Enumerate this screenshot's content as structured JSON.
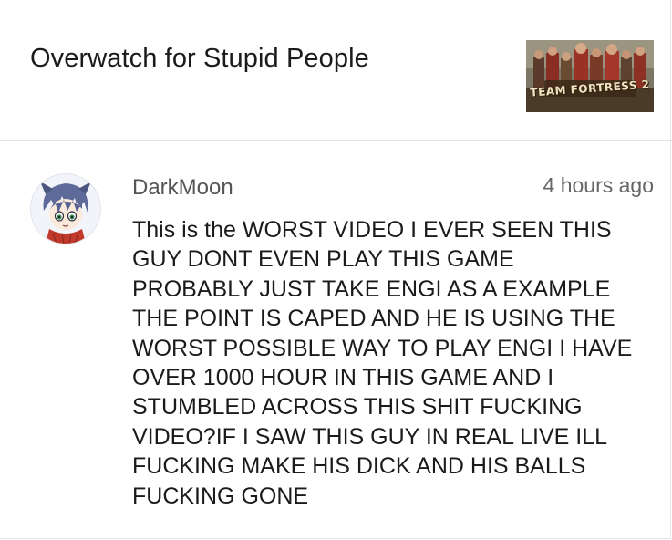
{
  "video": {
    "title": "Overwatch for Stupid People",
    "thumbnail_logo": "TEAM FORTRESS 2"
  },
  "comment": {
    "author": "DarkMoon",
    "timestamp": "4 hours ago",
    "text": "This is the WORST VIDEO I EVER SEEN THIS\nGUY DONT EVEN PLAY THIS GAME\nPROBABLY JUST TAKE ENGI AS A EXAMPLE\nTHE POINT IS CAPED AND HE IS USING THE\nWORST POSSIBLE WAY TO PLAY ENGI I HAVE\nOVER 1000 HOUR IN THIS GAME AND I\nSTUMBLED ACROSS THIS SHIT FUCKING\nVIDEO?IF I SAW THIS GUY IN REAL LIVE ILL\nFUCKING MAKE HIS DICK AND HIS BALLS\nFUCKING GONE"
  },
  "icons": {
    "avatar": "anime-avatar-icon",
    "thumbnail": "video-thumbnail"
  }
}
